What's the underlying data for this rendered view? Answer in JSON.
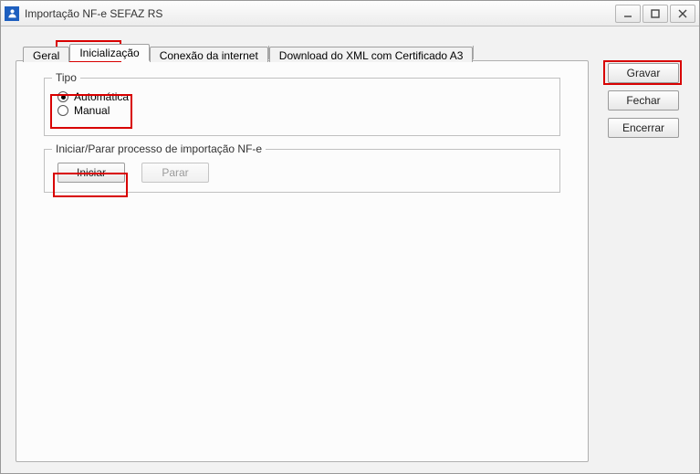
{
  "window": {
    "title": "Importação NF-e SEFAZ RS"
  },
  "tabs": {
    "geral": "Geral",
    "inicializacao": "Inicialização",
    "conexao": "Conexão da internet",
    "download": "Download do XML com Certificado A3"
  },
  "group_tipo": {
    "legend": "Tipo",
    "opt_auto": "Automática",
    "opt_manual": "Manual"
  },
  "group_proc": {
    "legend": "Iniciar/Parar processo de importação NF-e",
    "start": "Iniciar",
    "stop": "Parar"
  },
  "side": {
    "save": "Gravar",
    "close": "Fechar",
    "end": "Encerrar"
  }
}
